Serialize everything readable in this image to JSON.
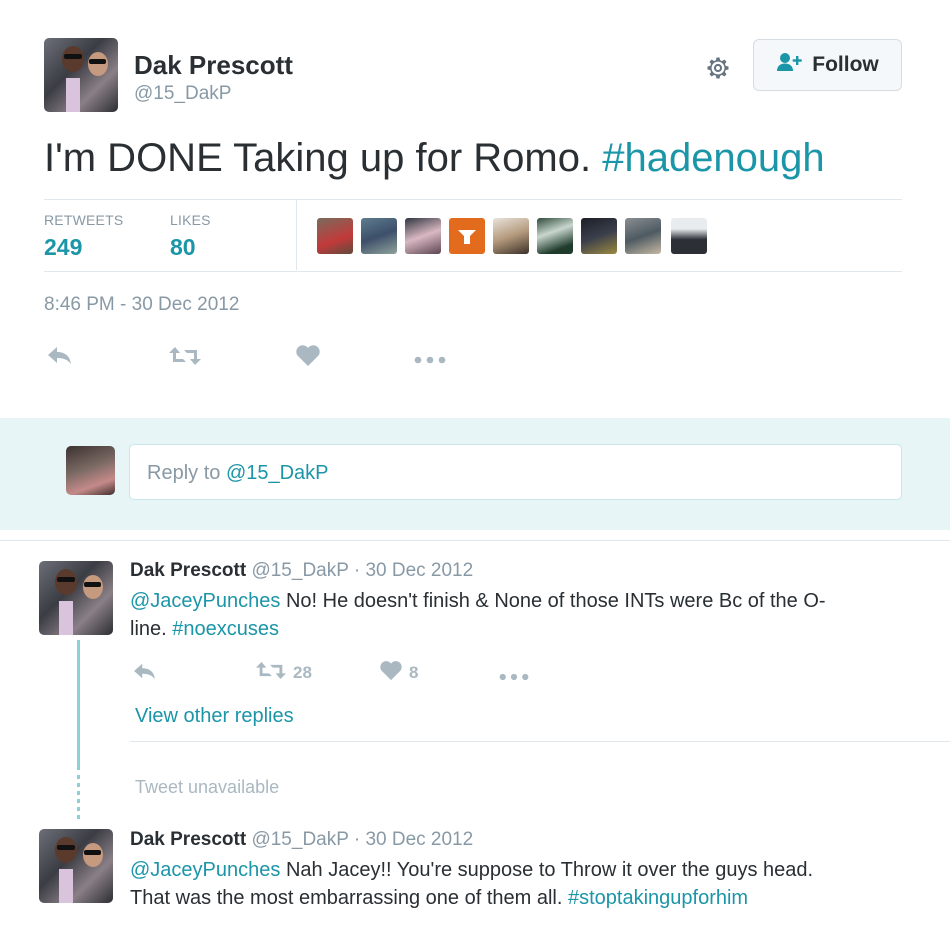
{
  "tweet": {
    "display_name": "Dak Prescott",
    "handle": "@15_DakP",
    "follow_label": "Follow",
    "text_plain": "I'm DONE Taking up for Romo. ",
    "text_hashtag": "#hadenough",
    "retweets_label": "RETWEETS",
    "retweets_count": "249",
    "likes_label": "LIKES",
    "likes_count": "80",
    "timestamp": "8:46 PM - 30 Dec 2012"
  },
  "reply_box": {
    "prefix": "Reply to ",
    "handle": "@15_DakP"
  },
  "replies": [
    {
      "display_name": "Dak Prescott",
      "meta": "@15_DakP · 30 Dec 2012",
      "mention": "@JaceyPunches",
      "text_line1": " No! He doesn't finish & None of those INTs were Bc of the O-",
      "text_line2": "line. ",
      "hashtag": "#noexcuses",
      "retweet_count": "28",
      "like_count": "8",
      "view_other": "View other replies"
    },
    {
      "unavailable": "Tweet unavailable"
    },
    {
      "display_name": "Dak Prescott",
      "meta": "@15_DakP · 30 Dec 2012",
      "mention": "@JaceyPunches",
      "text_line1": " Nah Jacey!! You're suppose to Throw it over the guys head.",
      "text_line2": "That was the most embarrassing one of them all. ",
      "hashtag": "#stoptakingupforhim"
    }
  ],
  "icons": [
    "settings-gear-icon",
    "follow-person-icon",
    "reply-icon",
    "retweet-icon",
    "like-heart-icon",
    "more-dots-icon"
  ],
  "colors": {
    "accent": "#1b95a8",
    "muted": "#8899a6",
    "reply_band": "#e8f5f7"
  }
}
